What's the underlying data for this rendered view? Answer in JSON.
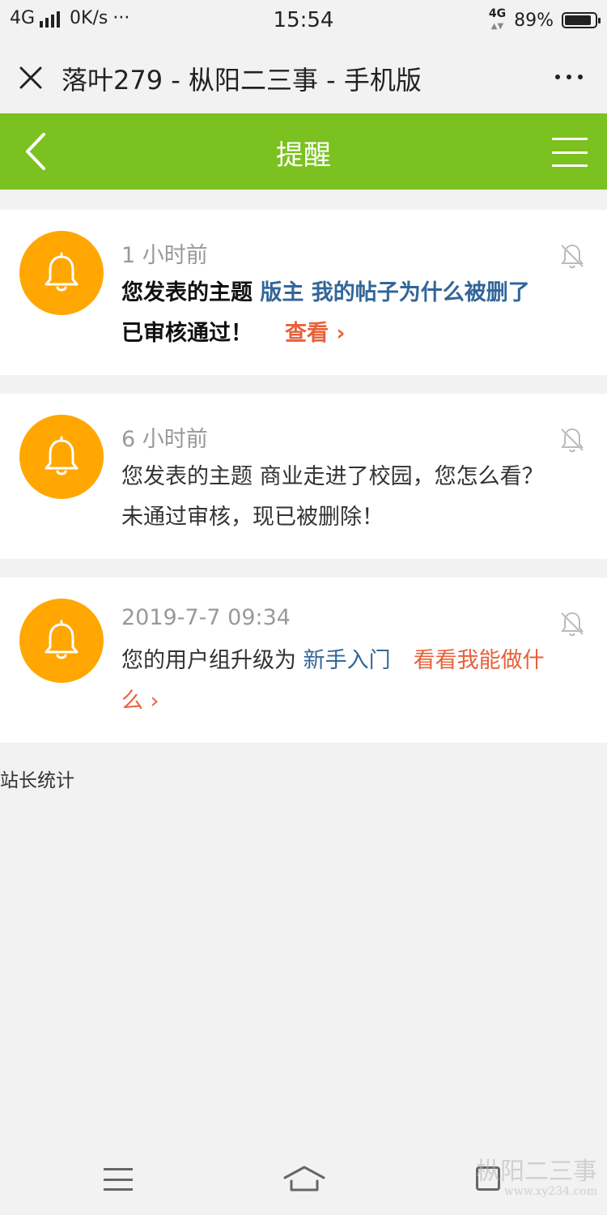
{
  "status_bar": {
    "network": "4G",
    "speed": "0K/s",
    "dots": "···",
    "time": "15:54",
    "network_right": "4G",
    "battery": "89%",
    "battery_level": 0.89
  },
  "browser": {
    "title": "落叶279 - 枞阳二三事 - 手机版"
  },
  "header": {
    "title": "提醒"
  },
  "notifications": [
    {
      "time": "1 小时前",
      "text_prefix": "您发表的主题 ",
      "link_text": "版主 我的帖子为什么被删了",
      "text_suffix": " 已审核通过！",
      "action": "查看 ›",
      "bold": true
    },
    {
      "time": "6 小时前",
      "text": "您发表的主题 商业走进了校园，您怎么看？ 未通过审核，现已被删除！"
    },
    {
      "time": "2019-7-7 09:34",
      "text_prefix": "您的用户组升级为 ",
      "link_text": "新手入门",
      "action": "看看我能做什么 ›"
    }
  ],
  "footer": {
    "text": "站长统计"
  },
  "watermark": {
    "text": "枞阳二三事",
    "url": "www.xy234.com"
  },
  "colors": {
    "header_green": "#7bc120",
    "avatar_orange": "#ffa700",
    "link_blue": "#336699",
    "action_red": "#e8613a"
  }
}
